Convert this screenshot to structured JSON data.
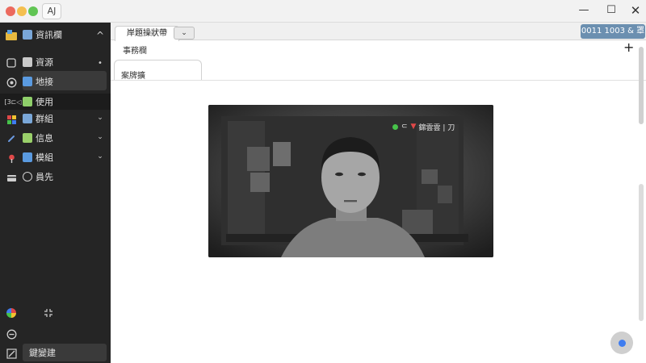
{
  "window": {
    "app_label": "AJ",
    "controls": {
      "minimize": "—",
      "maximize": "☐",
      "close": "✕"
    }
  },
  "sidebar": {
    "header": {
      "label": "資訊欄",
      "chevron": "^"
    },
    "items": [
      {
        "label": "資源",
        "icon": "folder-icon",
        "marker": "•"
      },
      {
        "label": "地接",
        "icon": "person-icon"
      },
      {
        "label": "使用",
        "icon": "user-icon"
      },
      {
        "label": "群組",
        "icon": "people-icon",
        "chevron": "⌄"
      },
      {
        "label": "信息",
        "icon": "message-icon",
        "chevron": "⌄"
      },
      {
        "label": "模組",
        "icon": "module-icon",
        "chevron": "⌄"
      },
      {
        "label": "員先",
        "icon": "search-icon"
      }
    ],
    "bottom": {
      "label": "鍵變建"
    }
  },
  "main": {
    "tab_label": "岸題操狀帶",
    "tab_dropdown": "⌄",
    "status_button": "0011 1003 & 罩",
    "subheader": "事務欄",
    "plus": "+",
    "section_label": "案牌擴"
  },
  "video": {
    "overlay_text": "錦雲雲 | 刀"
  },
  "colors": {
    "sidebar_bg": "#252525",
    "accent_blue": "#6b8fb0",
    "status_green": "#47c24a",
    "record_red": "#e04848",
    "fab_blue": "#3f7df0"
  }
}
